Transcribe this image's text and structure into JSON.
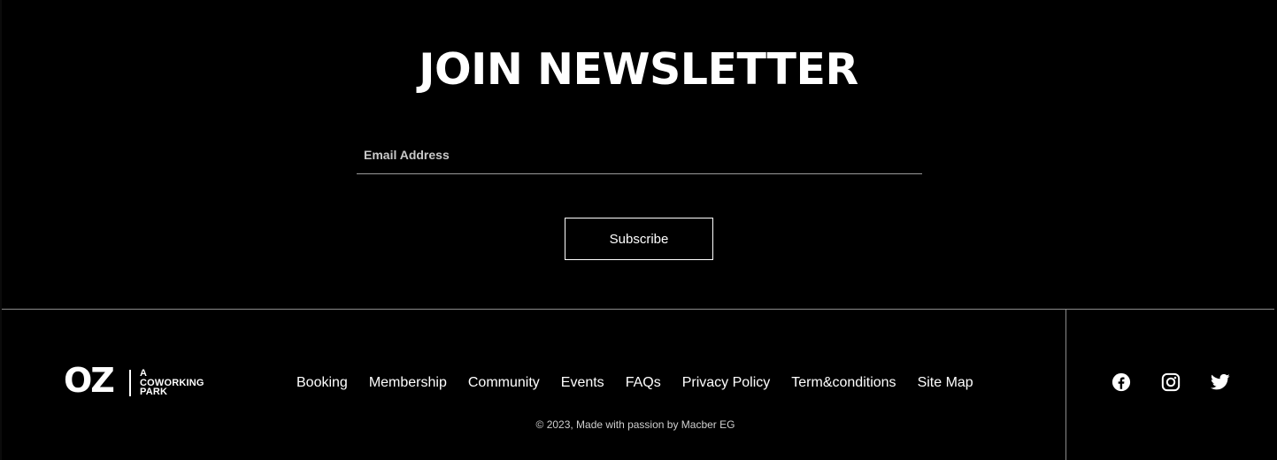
{
  "newsletter": {
    "title": "JOIN NEWSLETTER",
    "email_placeholder": "Email Address",
    "email_value": "",
    "subscribe_label": "Subscribe"
  },
  "footer": {
    "logo": {
      "mark": "OZ",
      "tagline": [
        "A",
        "COWORKING",
        "PARK"
      ]
    },
    "nav": [
      {
        "label": "Booking"
      },
      {
        "label": "Membership"
      },
      {
        "label": "Community"
      },
      {
        "label": "Events"
      },
      {
        "label": "FAQs"
      },
      {
        "label": "Privacy Policy"
      },
      {
        "label": "Term&conditions"
      },
      {
        "label": "Site Map"
      }
    ],
    "copyright": "© 2023, Made with passion by Macber EG",
    "social": [
      {
        "icon": "facebook-icon"
      },
      {
        "icon": "instagram-icon"
      },
      {
        "icon": "twitter-icon"
      }
    ]
  },
  "colors": {
    "background": "#000000",
    "foreground": "#ffffff",
    "divider": "#8a8a8a",
    "muted_text": "#cfcfcf"
  }
}
